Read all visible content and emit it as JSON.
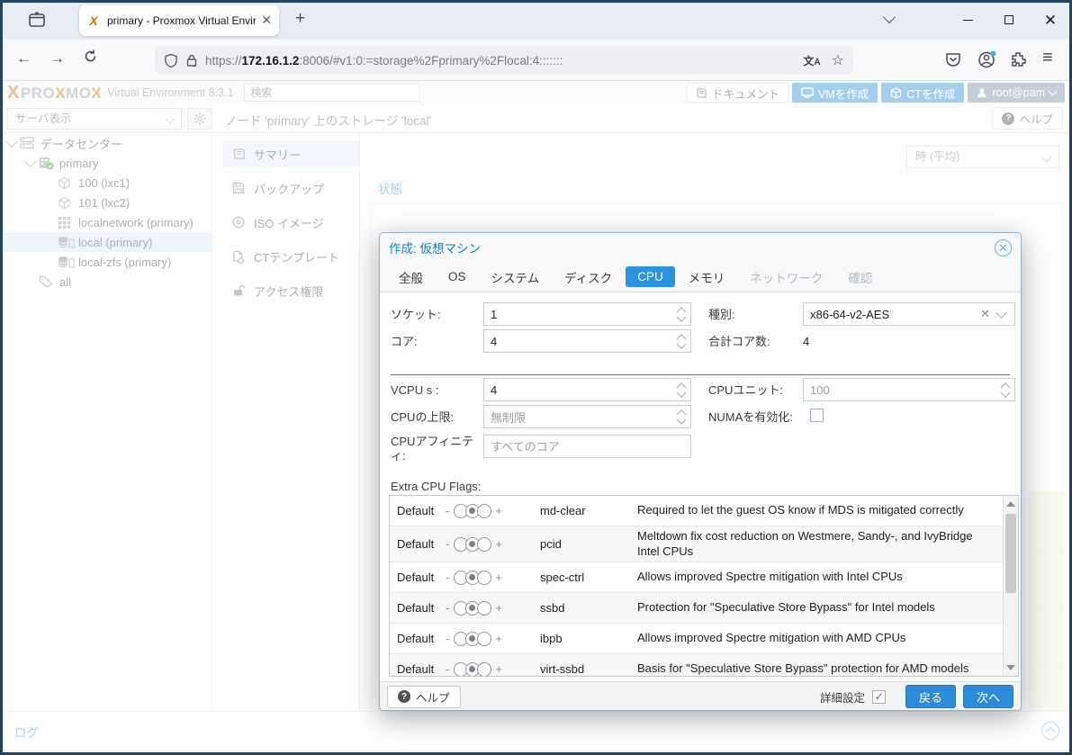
{
  "colors": {
    "accent": "#2e8bd8",
    "brand_orange": "#e57000",
    "title_blue": "#0d7fd0",
    "chart_fill": "#edf2d9"
  },
  "browser": {
    "tab_title": "primary - Proxmox Virtual Envir",
    "url_prefix": "https://",
    "url_host": "172.16.1.2",
    "url_rest": ":8006/#v1:0:=storage%2Fprimary%2Flocal:4:::::::"
  },
  "pve_header": {
    "logo_mark": "X",
    "logo_p1": "PRO",
    "logo_x1": "X",
    "logo_p2": "MO",
    "logo_x2": "X",
    "product": "Virtual Environment 8.3.1",
    "search_placeholder": "検索",
    "docs_button": "ドキュメント",
    "create_vm_button": "VMを作成",
    "create_ct_button": "CTを作成",
    "user_button": "root@pam"
  },
  "sidebar": {
    "view_select": "サーバ表示",
    "tree": [
      {
        "label": "データセンター",
        "icon": "server-icon",
        "level": 0,
        "expanded": true
      },
      {
        "label": "primary",
        "icon": "node-icon",
        "level": 1,
        "expanded": true
      },
      {
        "label": "100 (lxc1)",
        "icon": "cube-icon",
        "level": 2
      },
      {
        "label": "101 (lxc2)",
        "icon": "cube-icon",
        "level": 2
      },
      {
        "label": "localnetwork (primary)",
        "icon": "network-icon",
        "level": 2
      },
      {
        "label": "local (primary)",
        "icon": "storage-icon",
        "level": 2,
        "selected": true
      },
      {
        "label": "local-zfs (primary)",
        "icon": "storage-icon",
        "level": 2
      },
      {
        "label": "all",
        "icon": "tag-icon",
        "level": 1
      }
    ]
  },
  "content": {
    "breadcrumb": "ノード 'primary' 上のストレージ 'local'",
    "help_button": "ヘルプ",
    "menu": [
      {
        "label": "サマリー",
        "icon": "book-icon",
        "selected": true
      },
      {
        "label": "バックアップ",
        "icon": "floppy-icon"
      },
      {
        "label": "ISO イメージ",
        "icon": "disc-icon"
      },
      {
        "label": "CTテンプレート",
        "icon": "template-icon"
      },
      {
        "label": "アクセス権限",
        "icon": "permissions-icon"
      }
    ],
    "time_select": "時 (平均)",
    "status_title": "状態",
    "log_label": "ログ"
  },
  "dialog": {
    "title": "作成: 仮想マシン",
    "tabs": [
      {
        "label": "全般"
      },
      {
        "label": "OS"
      },
      {
        "label": "システム"
      },
      {
        "label": "ディスク"
      },
      {
        "label": "CPU",
        "active": true
      },
      {
        "label": "メモリ"
      },
      {
        "label": "ネットワーク",
        "disabled": true
      },
      {
        "label": "確認",
        "disabled": true
      }
    ],
    "fields": {
      "sockets_label": "ソケット:",
      "sockets_value": "1",
      "type_label": "種別:",
      "type_value": "x86-64-v2-AES",
      "cores_label": "コア:",
      "cores_value": "4",
      "total_label": "合計コア数:",
      "total_value": "4",
      "vcpus_label": "VCPU s :",
      "vcpus_value": "4",
      "units_label": "CPUユニット:",
      "units_value": "100",
      "limit_label": "CPUの上限:",
      "limit_value": "無制限",
      "numa_label": "NUMAを有効化:",
      "affinity_label": "CPUアフィニティ:",
      "affinity_placeholder": "すべてのコア"
    },
    "flags_title": "Extra CPU Flags:",
    "flags": [
      {
        "state": "Default",
        "name": "md-clear",
        "desc": "Required to let the guest OS know if MDS is mitigated correctly"
      },
      {
        "state": "Default",
        "name": "pcid",
        "desc": "Meltdown fix cost reduction on Westmere, Sandy-, and IvyBridge Intel CPUs"
      },
      {
        "state": "Default",
        "name": "spec-ctrl",
        "desc": "Allows improved Spectre mitigation with Intel CPUs"
      },
      {
        "state": "Default",
        "name": "ssbd",
        "desc": "Protection for \"Speculative Store Bypass\" for Intel models"
      },
      {
        "state": "Default",
        "name": "ibpb",
        "desc": "Allows improved Spectre mitigation with AMD CPUs"
      },
      {
        "state": "Default",
        "name": "virt-ssbd",
        "desc": "Basis for \"Speculative Store Bypass\" protection for AMD models"
      }
    ],
    "footer": {
      "help": "ヘルプ",
      "advanced": "詳細設定",
      "back": "戻る",
      "next": "次へ"
    }
  }
}
